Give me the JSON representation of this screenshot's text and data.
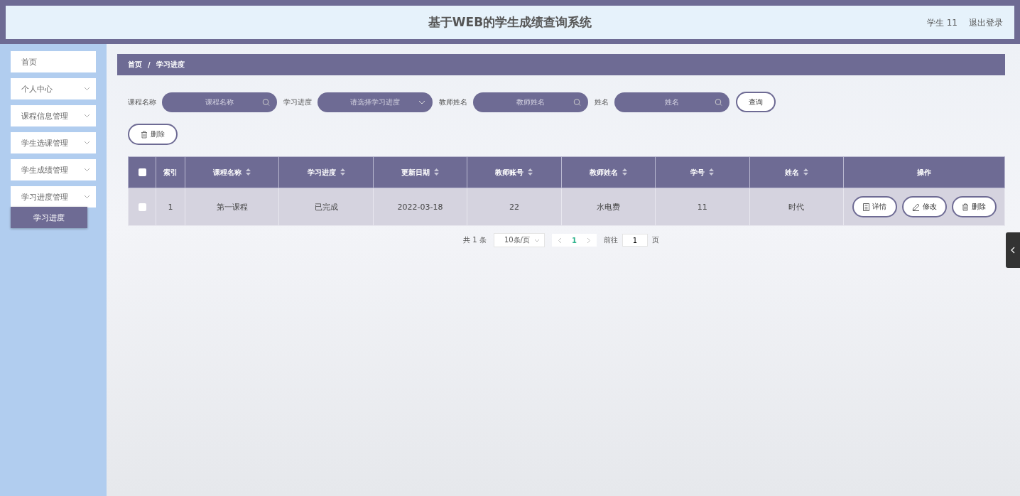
{
  "header": {
    "title": "基于WEB的学生成绩查询系统",
    "user": "学生 11",
    "logout": "退出登录"
  },
  "sidebar": {
    "items": [
      {
        "label": "首页",
        "has_submenu": false
      },
      {
        "label": "个人中心",
        "has_submenu": true
      },
      {
        "label": "课程信息管理",
        "has_submenu": true
      },
      {
        "label": "学生选课管理",
        "has_submenu": true
      },
      {
        "label": "学生成绩管理",
        "has_submenu": true
      },
      {
        "label": "学习进度管理",
        "has_submenu": true,
        "children": [
          {
            "label": "学习进度",
            "selected": true
          }
        ]
      }
    ]
  },
  "breadcrumb": [
    "首页",
    "学习进度"
  ],
  "breadcrumb_separator": "/",
  "filters": [
    {
      "label": "课程名称",
      "kind": "search",
      "placeholder": "课程名称"
    },
    {
      "label": "学习进度",
      "kind": "select",
      "placeholder": "请选择学习进度"
    },
    {
      "label": "教师姓名",
      "kind": "search",
      "placeholder": "教师姓名"
    },
    {
      "label": "姓名",
      "kind": "search",
      "placeholder": "姓名"
    }
  ],
  "query_button": "查询",
  "delete_button": "删除",
  "table": {
    "header_checked": false,
    "columns": [
      {
        "label": "索引",
        "sortable": false
      },
      {
        "label": "课程名称",
        "sortable": true
      },
      {
        "label": "学习进度",
        "sortable": true
      },
      {
        "label": "更新日期",
        "sortable": true
      },
      {
        "label": "教师账号",
        "sortable": true
      },
      {
        "label": "教师姓名",
        "sortable": true
      },
      {
        "label": "学号",
        "sortable": true
      },
      {
        "label": "姓名",
        "sortable": true
      },
      {
        "label": "操作",
        "sortable": false
      }
    ],
    "rows": [
      {
        "checked": false,
        "cells": [
          "1",
          "第一课程",
          "已完成",
          "2022-03-18",
          "22",
          "水电费",
          "11",
          "时代"
        ],
        "actions": [
          {
            "kind": "detail",
            "label": "详情"
          },
          {
            "kind": "edit",
            "label": "修改"
          },
          {
            "kind": "delete",
            "label": "删除"
          }
        ]
      }
    ]
  },
  "pagination": {
    "total": "共 1 条",
    "page_size": "10条/页",
    "pages": [
      {
        "label": "1",
        "selected": true
      }
    ],
    "goto_label": "前往",
    "goto_value": "1",
    "goto_suffix": "页"
  }
}
